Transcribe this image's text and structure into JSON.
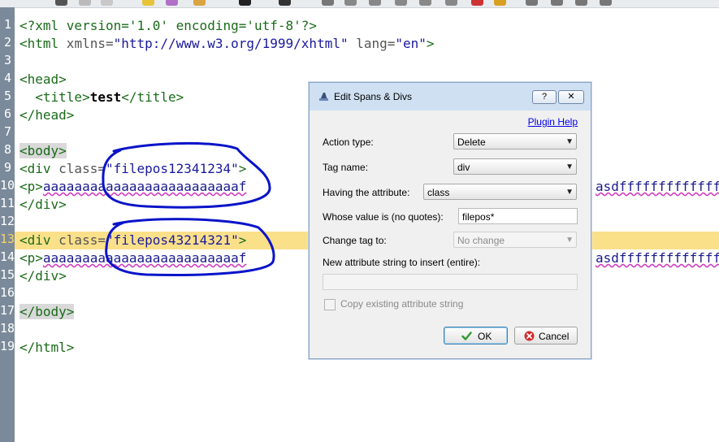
{
  "editor": {
    "line_numbers": [
      "1",
      "2",
      "3",
      "4",
      "5",
      "6",
      "7",
      "8",
      "9",
      "10",
      "11",
      "12",
      "13",
      "14",
      "15",
      "16",
      "17",
      "18",
      "19"
    ],
    "current_line": "13",
    "code": {
      "l1": "<?xml version='1.0' encoding='utf-8'?>",
      "l2_open": "<html",
      "l2_attr1": " xmlns=",
      "l2_val1": "\"http://www.w3.org/1999/xhtml\"",
      "l2_attr2": " lang=",
      "l2_val2": "\"en\"",
      "l2_close": ">",
      "l4": "<head>",
      "l5_open": "<title>",
      "l5_text": "test",
      "l5_close": "</title>",
      "l6": "</head>",
      "l8": "<body>",
      "l9_open": "<div",
      "l9_attr": " class=",
      "l9_val": "\"filepos12341234\"",
      "l9_close": ">",
      "l10_open": "<p>",
      "l10_text": "aaaaaaaaaaaaaaaaaaaaaaaaaf",
      "l11": "</div>",
      "l13_open": "<div",
      "l13_attr": " class=",
      "l13_val": "\"filepos43214321\"",
      "l13_close": ">",
      "l14_open": "<p>",
      "l14_text": "aaaaaaaaaaaaaaaaaaaaaaaaaf",
      "l15": "</div>",
      "l17": "</body>",
      "l19": "</html>"
    },
    "right_text_10": "asdfffffffffffffff",
    "right_text_14": "asdfffffffffffffff"
  },
  "dialog": {
    "title": "Edit Spans & Divs",
    "help_button": "?",
    "close_button": "✕",
    "plugin_help": "Plugin Help",
    "action_type_label": "Action type:",
    "action_type_value": "Delete",
    "tag_name_label": "Tag name:",
    "tag_name_value": "div",
    "having_attr_label": "Having the attribute:",
    "having_attr_value": "class",
    "whose_value_label": "Whose value is (no quotes):",
    "whose_value_value": "filepos*",
    "change_tag_label": "Change tag to:",
    "change_tag_value": "No change",
    "new_attr_label": "New attribute string to insert (entire):",
    "new_attr_value": "",
    "copy_existing_label": "Copy existing attribute string",
    "ok_label": "OK",
    "cancel_label": "Cancel"
  },
  "colors": {
    "gutter": "#7b8a9a",
    "current_line_highlight": "#fbe08a",
    "annotation_circle": "#0a14c8",
    "dialog_title_bar": "#cfe0f3"
  },
  "icons": {
    "dialog_title": "edit-spans-icon",
    "ok": "checkmark-icon",
    "cancel": "cancel-icon"
  }
}
